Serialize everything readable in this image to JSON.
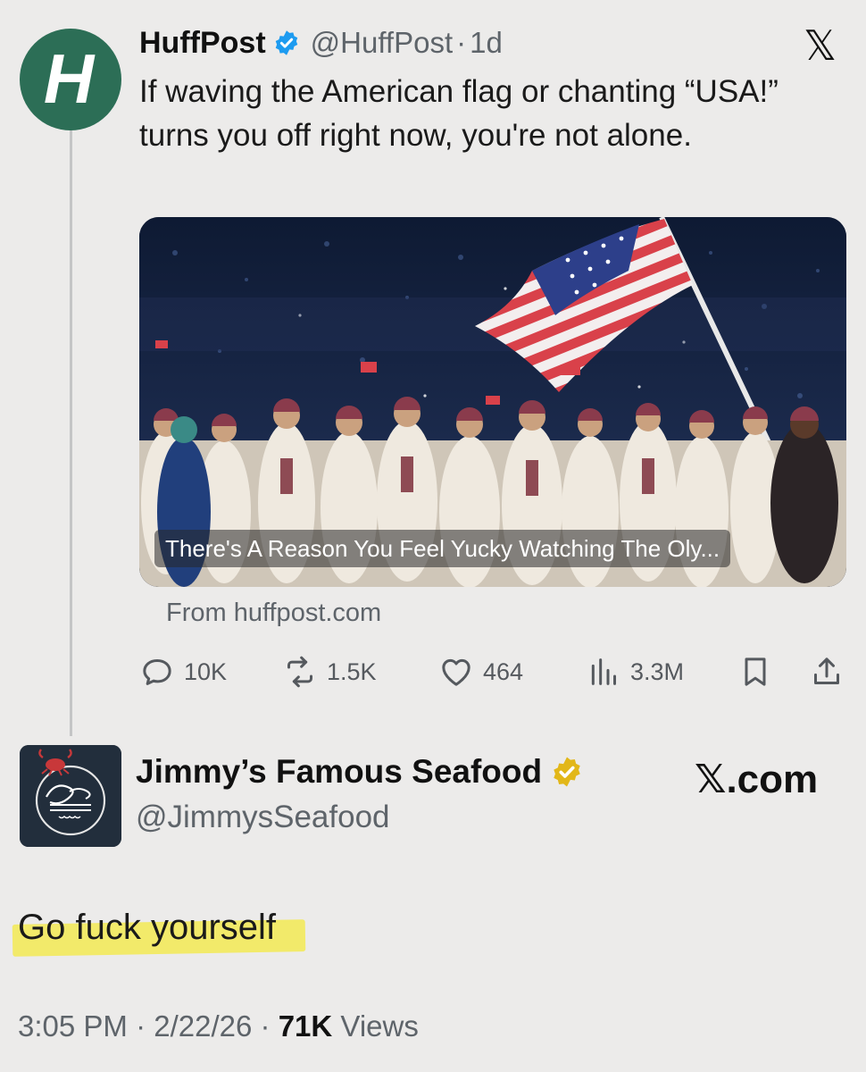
{
  "original_tweet": {
    "author_name": "HuffPost",
    "avatar_letter": "H",
    "handle": "@HuffPost",
    "separator": "·",
    "age": "1d",
    "text": "If waving the American flag or chanting “USA!” turns you off right now, you're not alone.",
    "link_card": {
      "headline": "There's A Reason You Feel Yucky Watching The Oly...",
      "source": "From huffpost.com"
    },
    "stats": {
      "replies": "10K",
      "reposts": "1.5K",
      "likes": "464",
      "views": "3.3M"
    }
  },
  "reply_tweet": {
    "author_name": "Jimmy’s Famous Seafood",
    "handle": "@JimmysSeafood",
    "text": "Go fuck yourself",
    "time": "3:05 PM",
    "date": "2/22/26",
    "views_count": "71K",
    "views_label": "Views"
  },
  "brand": {
    "x_logo": "𝕏",
    "x_com": "𝕏.com"
  },
  "colors": {
    "background": "#ecebea",
    "huffpost_green": "#2c6e56",
    "verified_blue": "#1d9bf0",
    "verified_gold": "#e2b719",
    "highlight": "#f2ea6a",
    "muted_text": "#5e646a"
  }
}
